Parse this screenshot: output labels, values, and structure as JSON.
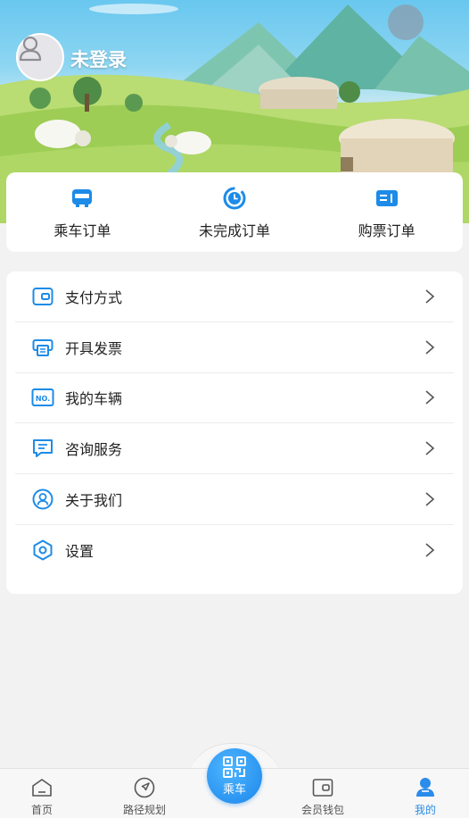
{
  "header": {
    "login_status": "未登录"
  },
  "orders": [
    {
      "label": "乘车订单",
      "icon": "bus-icon"
    },
    {
      "label": "未完成订单",
      "icon": "clock-icon"
    },
    {
      "label": "购票订单",
      "icon": "ticket-icon"
    }
  ],
  "menu": [
    {
      "label": "支付方式",
      "icon": "wallet-icon"
    },
    {
      "label": "开具发票",
      "icon": "printer-icon"
    },
    {
      "label": "我的车辆",
      "icon": "license-plate-icon"
    },
    {
      "label": "咨询服务",
      "icon": "chat-icon"
    },
    {
      "label": "关于我们",
      "icon": "user-circle-icon"
    },
    {
      "label": "设置",
      "icon": "settings-icon"
    }
  ],
  "tabbar": {
    "tabs": [
      {
        "label": "首页",
        "icon": "home-icon"
      },
      {
        "label": "路径规划",
        "icon": "navigation-icon"
      },
      {
        "label": "会员钱包",
        "icon": "wallet-icon"
      },
      {
        "label": "我的",
        "icon": "profile-icon"
      }
    ],
    "center_label": "乘车",
    "active": "我的"
  },
  "colors": {
    "accent": "#2a8cea",
    "background": "#f2f2f2",
    "card": "#ffffff"
  }
}
